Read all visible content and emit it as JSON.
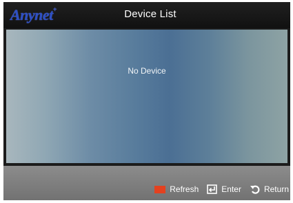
{
  "header": {
    "logo_text": "Anynet",
    "logo_plus": "+",
    "title": "Device List"
  },
  "list": {
    "empty_message": "No Device"
  },
  "footer": {
    "hints": [
      {
        "key": "red-button",
        "label": "Refresh",
        "color": "#e4411f"
      },
      {
        "key": "enter-icon",
        "label": "Enter"
      },
      {
        "key": "return-icon",
        "label": "Return"
      }
    ]
  },
  "colors": {
    "header_bg": "#1a1a1a",
    "footer_bg": "#808080",
    "panel_accent": "#4b6f94"
  }
}
